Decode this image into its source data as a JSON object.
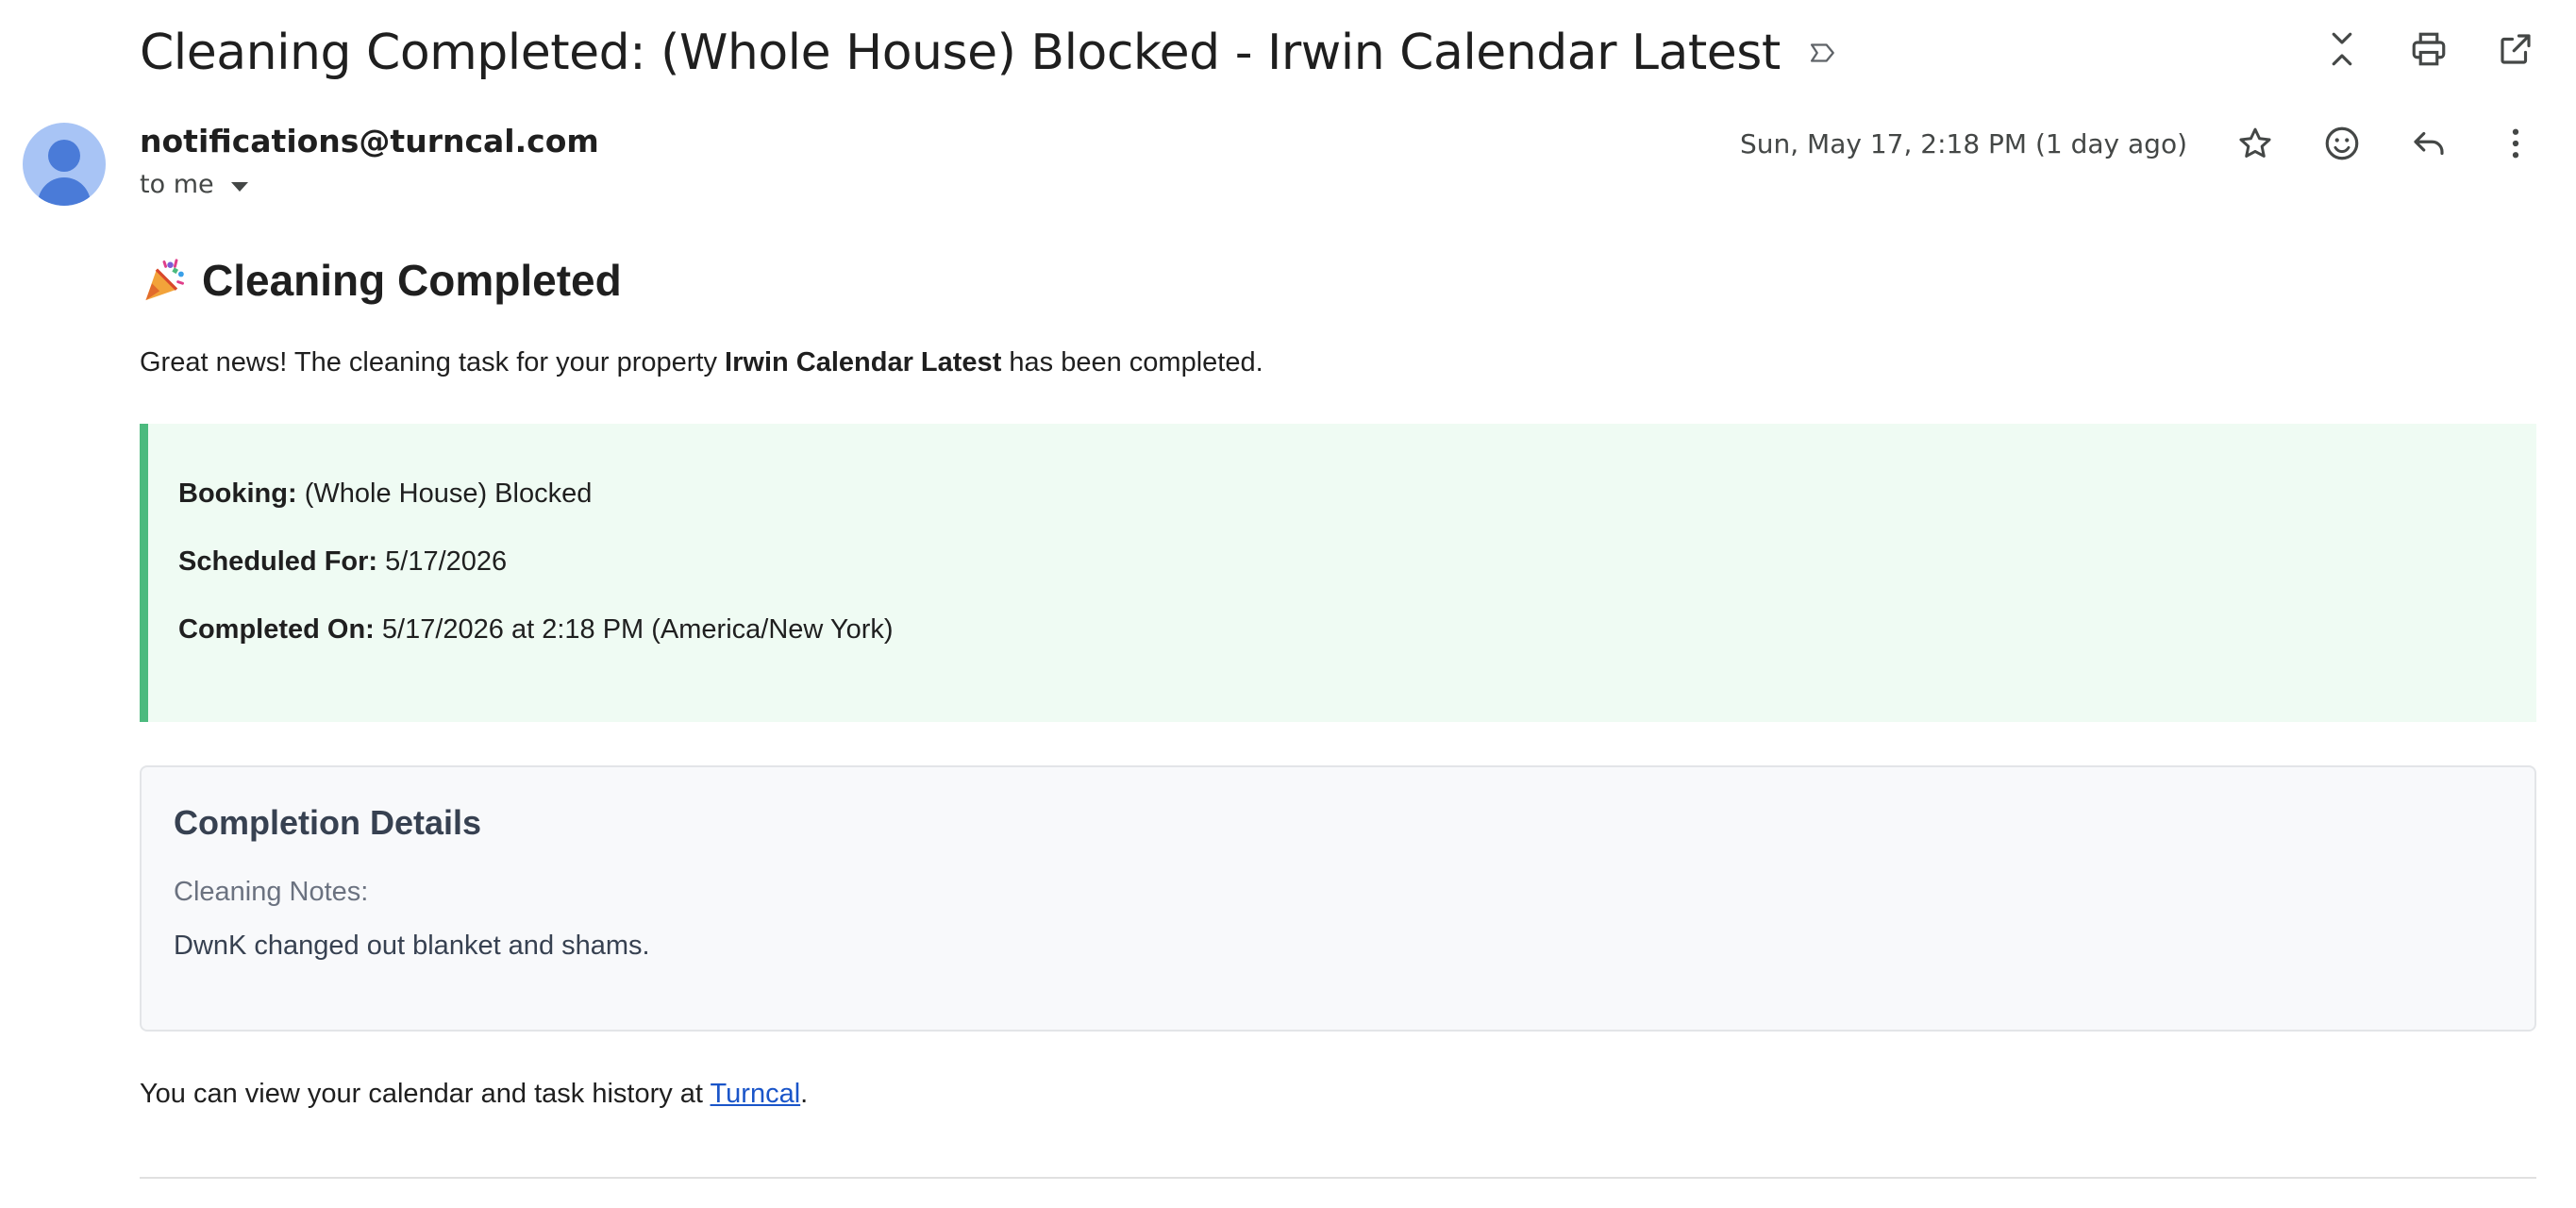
{
  "subject": "Cleaning Completed: (Whole House) Blocked - Irwin Calendar Latest",
  "icons": {
    "label": "label-outline-icon",
    "collapse": "collapse-all-icon",
    "print": "print-icon",
    "open_new": "open-in-new-window-icon",
    "star": "star-outline-icon",
    "emoji": "emoji-reaction-icon",
    "reply": "reply-icon",
    "more": "more-vertical-icon",
    "party": "party-popper-icon"
  },
  "sender": {
    "email": "notifications@turncal.com",
    "recipient": "to me",
    "date": "Sun, May 17, 2:18 PM (1 day ago)"
  },
  "body": {
    "heading": "Cleaning Completed",
    "intro_before": "Great news! The cleaning task for your property ",
    "intro_property": "Irwin Calendar Latest",
    "intro_after": " has been completed.",
    "booking_label": "Booking:",
    "booking_value": " (Whole House) Blocked",
    "scheduled_label": "Scheduled For:",
    "scheduled_value": " 5/17/2026",
    "completed_label": "Completed On:",
    "completed_value": " 5/17/2026 at 2:18 PM (America/New York)",
    "details_title": "Completion Details",
    "notes_label": "Cleaning Notes:",
    "notes_text": "DwnK changed out blanket and shams.",
    "footer_before": "You can view your calendar and task history at ",
    "footer_link": "Turncal",
    "footer_after": "."
  },
  "colors": {
    "accent_green": "#4cba7e",
    "green_bg": "#effbf3",
    "link": "#1a55c9",
    "avatar_bg": "#a8c4f5"
  }
}
